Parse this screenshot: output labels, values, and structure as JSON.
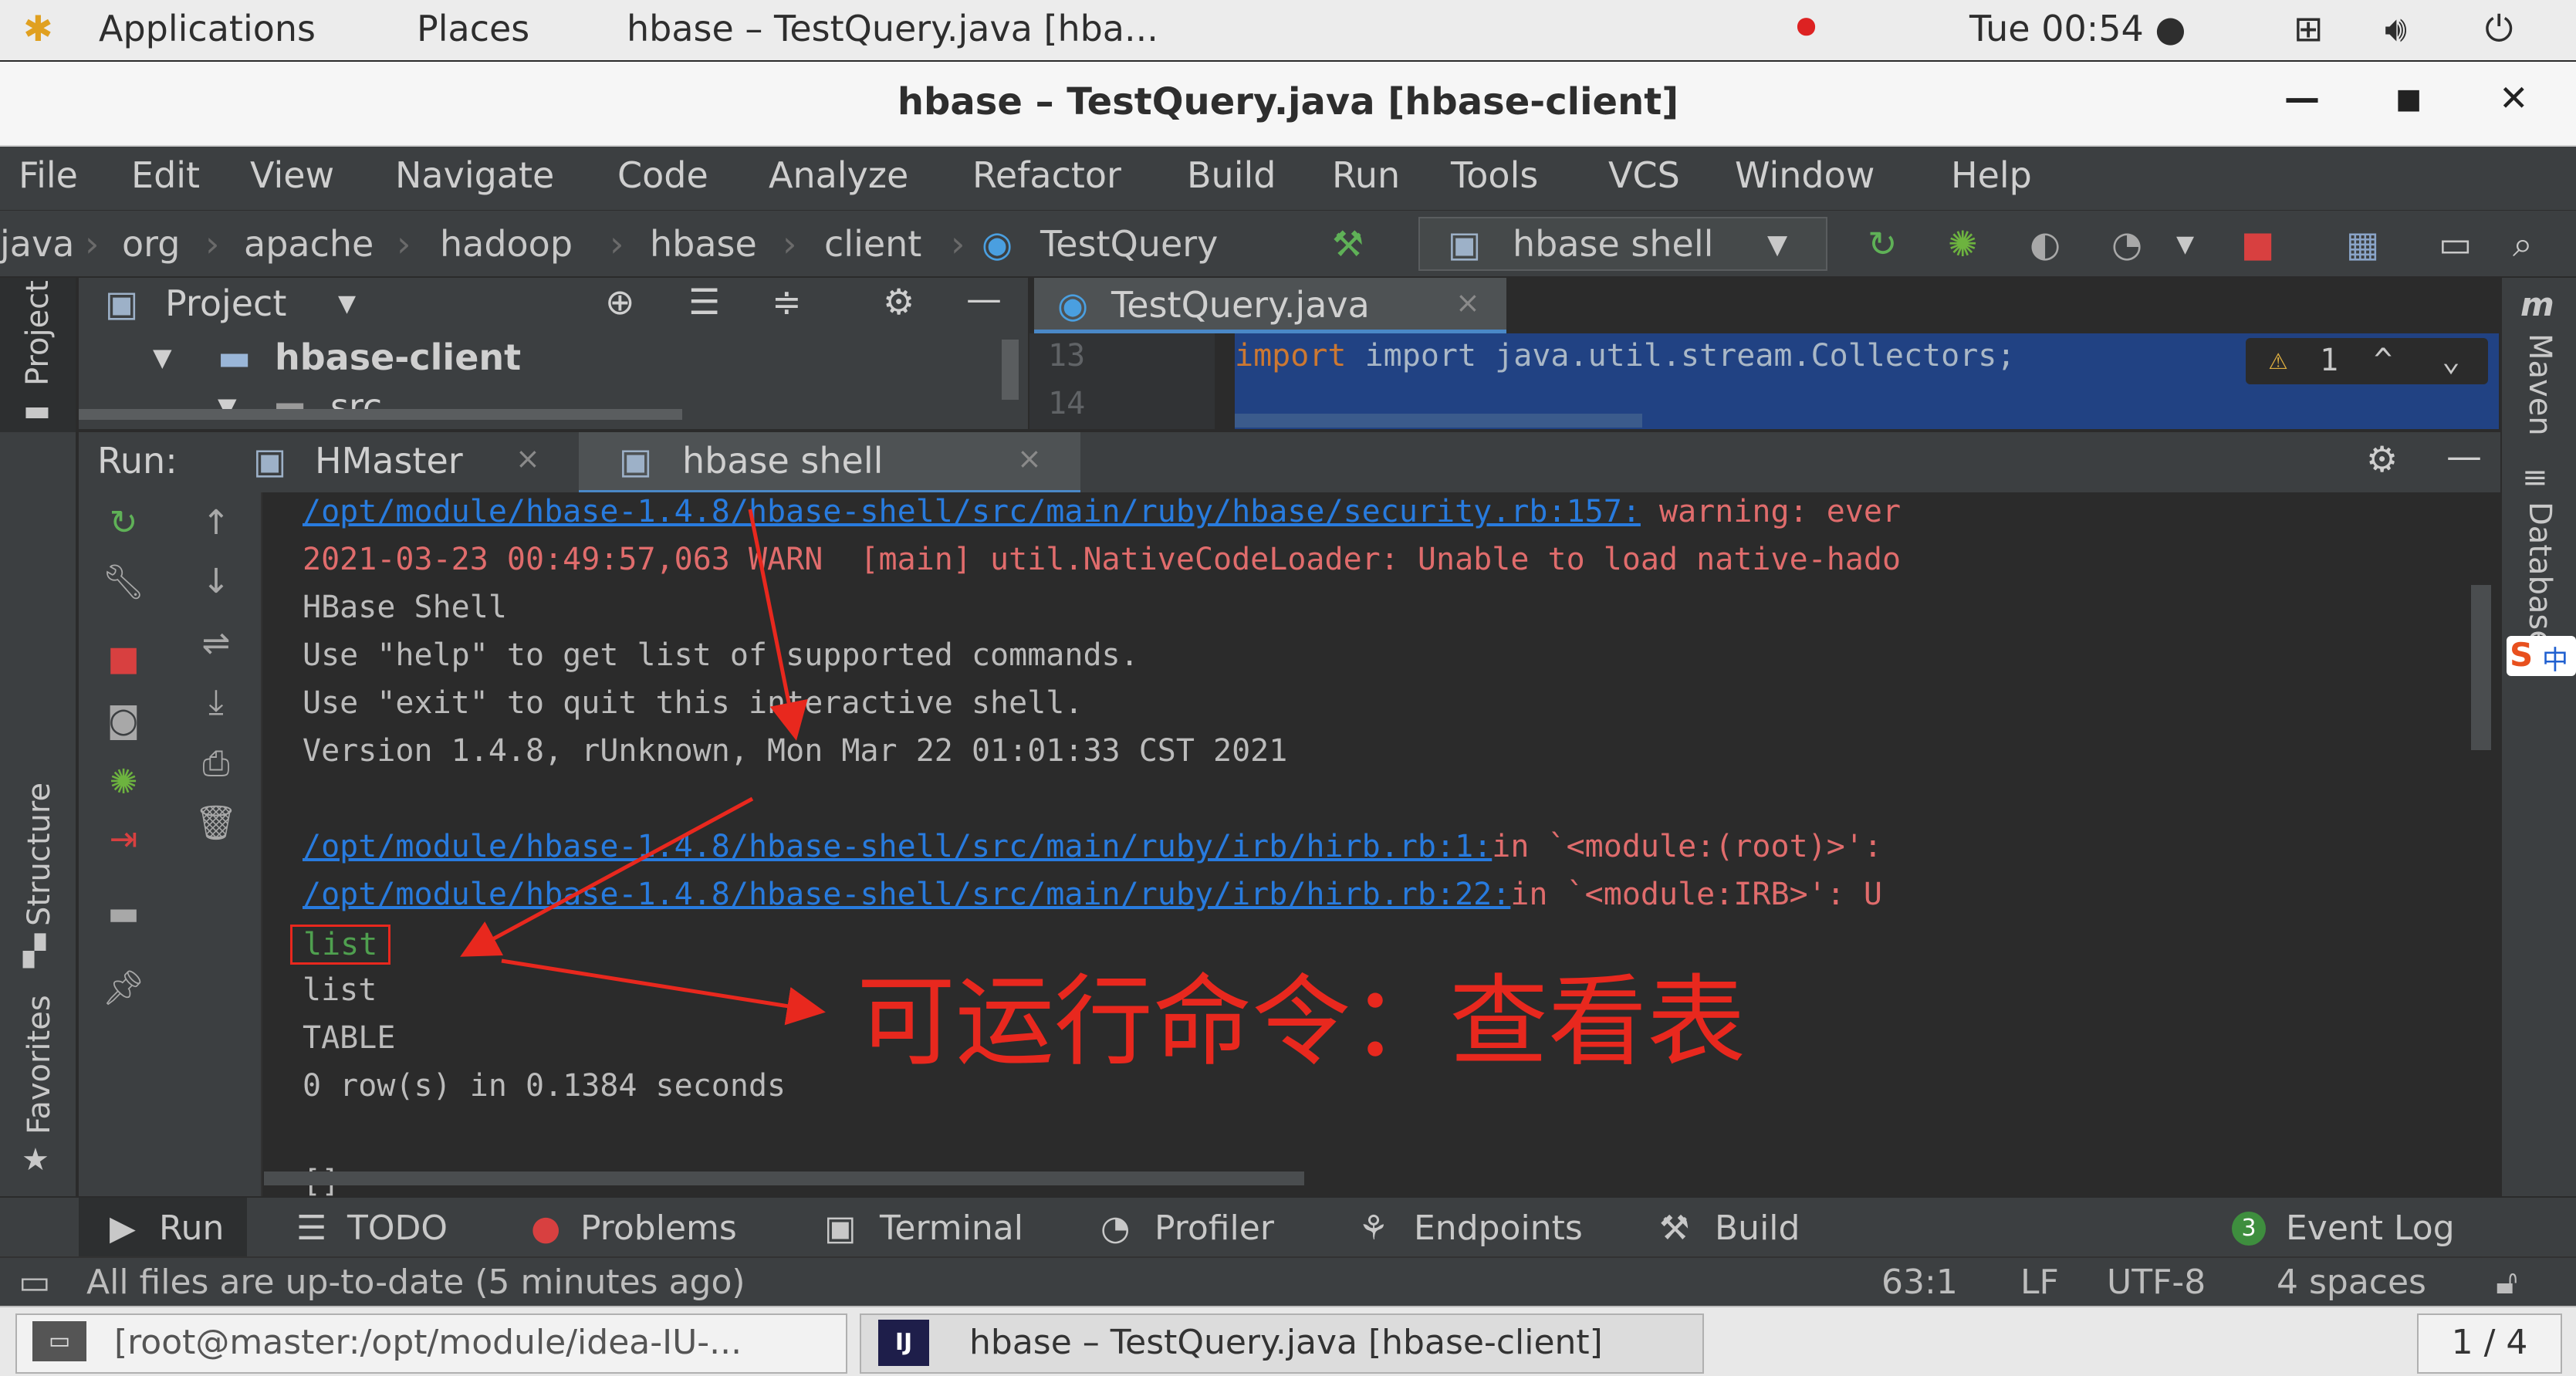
{
  "gnome_bar": {
    "applications": "Applications",
    "places": "Places",
    "active_window": "hbase – TestQuery.java [hba...",
    "clock": "Tue 00:54 ●"
  },
  "window": {
    "title": "hbase – TestQuery.java [hbase-client]"
  },
  "menu": {
    "items": [
      "File",
      "Edit",
      "View",
      "Navigate",
      "Code",
      "Analyze",
      "Refactor",
      "Build",
      "Run",
      "Tools",
      "VCS",
      "Window",
      "Help"
    ]
  },
  "nav": {
    "breadcrumb": [
      "java",
      "org",
      "apache",
      "hadoop",
      "hbase",
      "client",
      "TestQuery"
    ],
    "run_config": "hbase shell"
  },
  "left_strip": {
    "project": "Project",
    "structure": "Structure",
    "favorites": "Favorites"
  },
  "right_strip": {
    "maven": "Maven",
    "database": "Database"
  },
  "project_panel": {
    "title": "Project",
    "root": "hbase-client",
    "child": "src"
  },
  "editor": {
    "tab": "TestQuery.java",
    "line_numbers": [
      "13",
      "14"
    ],
    "code_line": "import java.util.stream.Collectors;",
    "warning_count": "1"
  },
  "run_panel": {
    "label": "Run:",
    "tabs": [
      "HMaster",
      "hbase shell"
    ]
  },
  "console": {
    "lines": [
      {
        "link": "/opt/module/hbase-1.4.8/hbase-shell/src/main/ruby/hbase/security.rb:157:",
        "text": " warning: ever"
      },
      {
        "warn": "2021-03-23 00:49:57,063 WARN  [main] util.NativeCodeLoader: Unable to load native-hado"
      },
      {
        "text": "HBase Shell"
      },
      {
        "text": "Use \"help\" to get list of supported commands."
      },
      {
        "text": "Use \"exit\" to quit this interactive shell."
      },
      {
        "text": "Version 1.4.8, rUnknown, Mon Mar 22 01:01:33 CST 2021"
      },
      {
        "text": ""
      },
      {
        "link": "/opt/module/hbase-1.4.8/hbase-shell/src/main/ruby/irb/hirb.rb:1:",
        "warn": "in `<module:(root)>':"
      },
      {
        "link": "/opt/module/hbase-1.4.8/hbase-shell/src/main/ruby/irb/hirb.rb:22:",
        "warn": "in `<module:IRB>': U"
      },
      {
        "input": "list"
      },
      {
        "text": "list"
      },
      {
        "text": "TABLE"
      },
      {
        "text": "0 row(s) in 0.1384 seconds"
      },
      {
        "text": ""
      },
      {
        "text": "[]"
      }
    ]
  },
  "annotation": {
    "text": "可运行命令：查看表",
    "color": "#e8281e"
  },
  "bottom_tabs": {
    "run": "Run",
    "todo": "TODO",
    "problems": "Problems",
    "terminal": "Terminal",
    "profiler": "Profiler",
    "endpoints": "Endpoints",
    "build": "Build",
    "event_log_badge": "3",
    "event_log": "Event Log"
  },
  "status": {
    "message": "All files are up-to-date (5 minutes ago)",
    "position": "63:1",
    "line_sep": "LF",
    "encoding": "UTF-8",
    "indent": "4 spaces"
  },
  "taskbar": {
    "terminal_task": "[root@master:/opt/module/idea-IU-...",
    "idea_task": "hbase – TestQuery.java [hbase-client]",
    "workspace": "1 / 4"
  },
  "colors": {
    "accent": "#4a88c7",
    "link": "#287bde",
    "warning": "#e06c6c",
    "annotation": "#e8281e"
  }
}
